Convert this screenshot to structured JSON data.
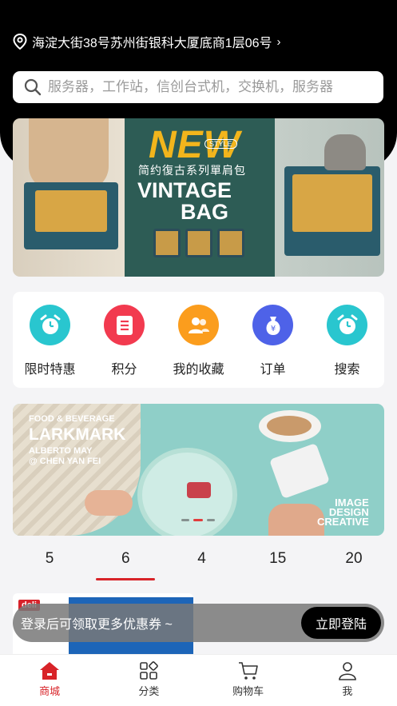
{
  "header": {
    "location": "海淀大街38号苏州街银科大厦底商1层06号",
    "search_placeholder": "服务器，工作站，信创台式机，交换机，服务器"
  },
  "banner1": {
    "new_text": "NEW",
    "style_text": "STYLE",
    "subtitle": "简约復古系列單肩包",
    "vintage_text": "VINTAGE",
    "bag_text": "BAG"
  },
  "quick_menu": [
    {
      "label": "限时特惠",
      "icon": "alarm-clock-icon",
      "color": "#29c6cf"
    },
    {
      "label": "积分",
      "icon": "document-icon",
      "color": "#f23a4f"
    },
    {
      "label": "我的收藏",
      "icon": "users-icon",
      "color": "#fb9d1d"
    },
    {
      "label": "订单",
      "icon": "money-bag-icon",
      "color": "#4e62e8"
    },
    {
      "label": "搜索",
      "icon": "alarm-clock-icon",
      "color": "#29c6cf"
    }
  ],
  "banner2": {
    "line1": "FOOD & BEVERAGE",
    "line2": "LARKMARK",
    "line3": "ALBERTO MAY",
    "line4": "@ CHEN YAN FEI",
    "image_line1": "IMAGE",
    "image_line2": "DESIGN",
    "image_line3": "CREATIVE"
  },
  "category_tabs": [
    "5",
    "6",
    "4",
    "15",
    "20"
  ],
  "active_tab_index": 1,
  "product": {
    "brand": "deli"
  },
  "login_bar": {
    "text": "登录后可领取更多优惠券 ~",
    "button": "立即登陆"
  },
  "bottom_nav": [
    {
      "label": "商城",
      "icon": "home-icon",
      "active": true
    },
    {
      "label": "分类",
      "icon": "category-grid-icon",
      "active": false
    },
    {
      "label": "购物车",
      "icon": "cart-icon",
      "active": false
    },
    {
      "label": "我",
      "icon": "user-icon",
      "active": false
    }
  ],
  "colors": {
    "accent": "#d82328",
    "header_bg": "#000000"
  }
}
